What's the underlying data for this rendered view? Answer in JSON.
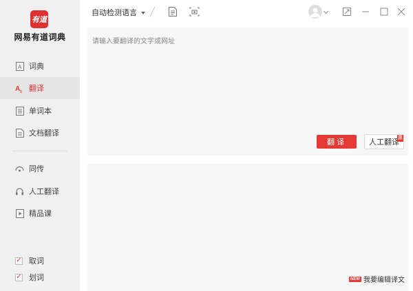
{
  "app": {
    "logo_text": "有道",
    "name": "网易有道词典"
  },
  "sidebar": {
    "items": [
      {
        "label": "词典",
        "icon": "dictionary-icon",
        "active": false
      },
      {
        "label": "翻译",
        "icon": "translate-icon",
        "active": true
      },
      {
        "label": "单词本",
        "icon": "wordbook-icon",
        "active": false
      },
      {
        "label": "文档翻译",
        "icon": "document-icon",
        "active": false
      },
      {
        "label": "同传",
        "icon": "simultaneous-icon",
        "active": false
      },
      {
        "label": "人工翻译",
        "icon": "headset-icon",
        "active": false
      },
      {
        "label": "精品课",
        "icon": "course-icon",
        "active": false
      }
    ],
    "checks": [
      {
        "label": "取词",
        "checked": true
      },
      {
        "label": "划词",
        "checked": true
      }
    ]
  },
  "toolbar": {
    "language_select": "自动检测语言"
  },
  "input": {
    "placeholder": "请输入要翻译的文字或网址",
    "translate_button": "翻译",
    "human_button": "人工翻译",
    "human_badge": "惠"
  },
  "output": {
    "edit_badge": "NEW",
    "edit_label": "我要编辑译文"
  },
  "colors": {
    "accent": "#e53935",
    "sidebar_bg": "#f0f0f0",
    "panel_bg": "#f6f6f7"
  }
}
